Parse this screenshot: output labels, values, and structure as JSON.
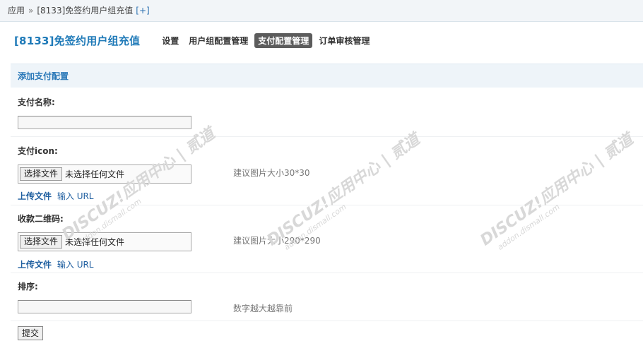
{
  "breadcrumb": {
    "root": "应用",
    "separator": "»",
    "current": "[8133]免签约用户组充值",
    "add": "[+]"
  },
  "header": {
    "title": "[8133]免签约用户组充值",
    "tabs": [
      {
        "label": "设置",
        "active": false
      },
      {
        "label": "用户组配置管理",
        "active": false
      },
      {
        "label": "支付配置管理",
        "active": true
      },
      {
        "label": "订单审核管理",
        "active": false
      }
    ]
  },
  "section": {
    "title": "添加支付配置"
  },
  "form": {
    "name": {
      "label": "支付名称:",
      "value": ""
    },
    "icon": {
      "label": "支付icon:",
      "file_button": "选择文件",
      "file_status": "未选择任何文件",
      "tip": "建议图片大小30*30",
      "upload_label": "上传文件",
      "input_label": "输入",
      "url_label": "URL"
    },
    "qrcode": {
      "label": "收款二维码:",
      "file_button": "选择文件",
      "file_status": "未选择任何文件",
      "tip": "建议图片大小290*290",
      "upload_label": "上传文件",
      "input_label": "输入",
      "url_label": "URL"
    },
    "sort": {
      "label": "排序:",
      "value": "",
      "tip": "数字越大越靠前"
    },
    "submit_label": "提交"
  },
  "watermark": {
    "brand": "DISCUZ!",
    "cn": "应用中心",
    "sub": "贰道",
    "url": "addon.dismall.com"
  }
}
